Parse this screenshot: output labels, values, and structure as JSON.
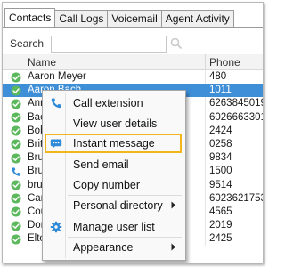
{
  "tabs": [
    {
      "label": "Contacts",
      "active": true
    },
    {
      "label": "Call Logs",
      "active": false
    },
    {
      "label": "Voicemail",
      "active": false
    },
    {
      "label": "Agent Activity",
      "active": false
    }
  ],
  "search": {
    "label": "Search",
    "value": "",
    "placeholder": ""
  },
  "columns": {
    "name": "Name",
    "phone": "Phone"
  },
  "contacts": [
    {
      "name": "Aaron Meyer",
      "phone": "480",
      "status": "available",
      "selected": false
    },
    {
      "name": "Aaron Bach",
      "phone": "1011",
      "status": "available",
      "selected": true
    },
    {
      "name": "Anne",
      "phone": "6263845019",
      "status": "available",
      "selected": false
    },
    {
      "name": "Bach",
      "phone": "6026663301",
      "status": "available",
      "selected": false
    },
    {
      "name": "Bob",
      "phone": "2424",
      "status": "available",
      "selected": false
    },
    {
      "name": "Britt",
      "phone": "0258",
      "status": "available",
      "selected": false
    },
    {
      "name": "Bruce",
      "phone": "9834",
      "status": "available",
      "selected": false
    },
    {
      "name": "Bruce",
      "phone": "1500",
      "status": "on-call",
      "selected": false
    },
    {
      "name": "bruno",
      "phone": "9514",
      "status": "available",
      "selected": false
    },
    {
      "name": "Carl",
      "phone": "6023621753",
      "status": "available",
      "selected": false
    },
    {
      "name": "Courtney",
      "phone": "4565",
      "status": "available",
      "selected": false
    },
    {
      "name": "Don",
      "phone": "2019",
      "status": "available",
      "selected": false
    },
    {
      "name": "Elton John",
      "phone": "2425",
      "status": "available",
      "selected": false
    }
  ],
  "context_menu": {
    "items": [
      {
        "label": "Call extension",
        "icon": "phone-icon",
        "submenu": false,
        "highlighted": false
      },
      {
        "label": "View user details",
        "icon": "",
        "submenu": false,
        "highlighted": false
      },
      {
        "label": "Instant message",
        "icon": "chat-bubble-icon",
        "submenu": false,
        "highlighted": true
      },
      {
        "label": "Send email",
        "icon": "",
        "submenu": false,
        "highlighted": false
      },
      {
        "label": "Copy number",
        "icon": "",
        "submenu": false,
        "highlighted": false
      },
      {
        "label": "Personal directory",
        "icon": "",
        "submenu": true,
        "highlighted": false
      },
      {
        "label": "Manage user list",
        "icon": "gear-icon",
        "submenu": false,
        "highlighted": false
      },
      {
        "label": "Appearance",
        "icon": "",
        "submenu": true,
        "highlighted": false
      }
    ]
  },
  "colors": {
    "selected_row": "#3e8fd8",
    "status_available": "#5cb85c",
    "highlight_border": "#f3b61a",
    "icon_blue": "#2f8ad8"
  }
}
